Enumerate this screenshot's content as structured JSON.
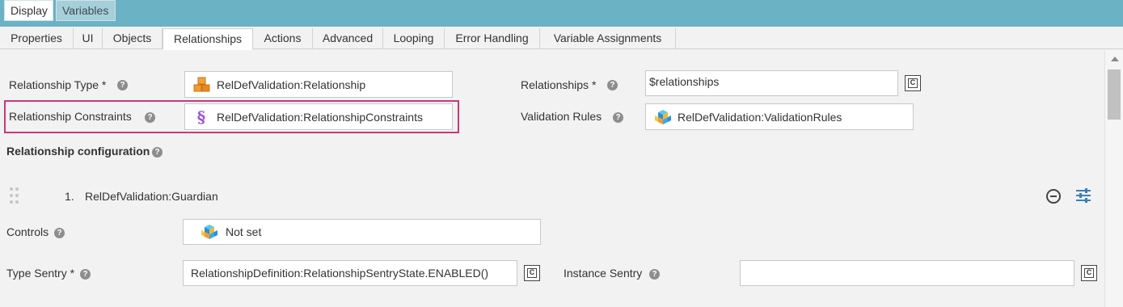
{
  "top_tabs": {
    "display": "Display",
    "variables": "Variables"
  },
  "tabs": [
    "Properties",
    "UI",
    "Objects",
    "Relationships",
    "Actions",
    "Advanced",
    "Looping",
    "Error Handling",
    "Variable Assignments"
  ],
  "form": {
    "relationship_type": {
      "label": "Relationship Type *",
      "value": "RelDefValidation:Relationship",
      "icon": "boxes-icon"
    },
    "relationship_constraints": {
      "label": "Relationship Constraints",
      "value": "RelDefValidation:RelationshipConstraints",
      "icon": "section-sign-icon"
    },
    "relationships": {
      "label": "Relationships *",
      "value": "$relationships"
    },
    "validation_rules": {
      "label": "Validation Rules",
      "value": "RelDefValidation:ValidationRules",
      "icon": "cubes-icon"
    }
  },
  "config": {
    "heading": "Relationship configuration",
    "item_index": "1.",
    "item_name": "RelDefValidation:Guardian",
    "controls": {
      "label": "Controls",
      "value": "Not set"
    },
    "type_sentry": {
      "label": "Type Sentry *",
      "value": "RelationshipDefinition:RelationshipSentryState.ENABLED()"
    },
    "instance_sentry": {
      "label": "Instance Sentry",
      "value": ""
    }
  },
  "help_glyph": "?",
  "fx_glyph": "C",
  "colors": {
    "topbar": "#6ab2c4",
    "highlight": "#c8387a",
    "settings": "#3a7fbf"
  }
}
